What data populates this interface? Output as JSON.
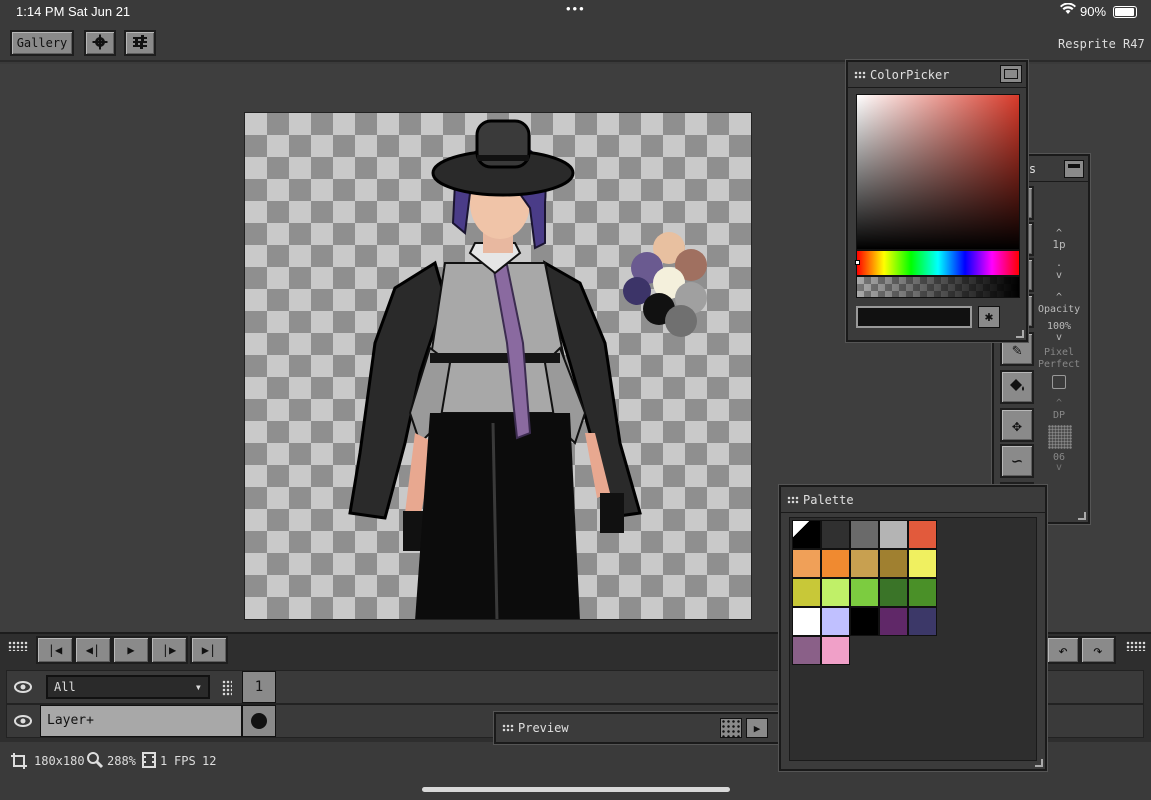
{
  "status": {
    "time": "1:14 PM",
    "date": "Sat Jun 21",
    "battery": "90%"
  },
  "toolbar": {
    "gallery_label": "Gallery",
    "app_name": "Resprite R47"
  },
  "colorpicker": {
    "title": "ColorPicker",
    "hex_value": ""
  },
  "tools": {
    "title": "Tools",
    "brush_size": "1p",
    "opacity_label": "Opacity",
    "opacity_value": "100%",
    "pixel_perfect_label_1": "Pixel",
    "pixel_perfect_label_2": "Perfect",
    "dp_label": "DP",
    "dp_value": "06"
  },
  "palette": {
    "title": "Palette",
    "colors": [
      "#000000",
      "#303030",
      "#6a6a6a",
      "#b4b4b4",
      "#e25a3c",
      "#f0a058",
      "#f08a30",
      "#c8a050",
      "#a08030",
      "#f0f060",
      "#c8c838",
      "#c0f068",
      "#7ccc40",
      "#3a7428",
      "#4a9028",
      "#ffffff",
      "#c0c0ff",
      "#000000",
      "#602868",
      "#3c3868",
      "#8a6088",
      "#f0a0c8"
    ]
  },
  "preview": {
    "title": "Preview"
  },
  "layers": {
    "filter": "All",
    "frame_number": "1",
    "layer_name": "Layer+"
  },
  "info": {
    "canvas_size": "180x180",
    "zoom": "288%",
    "frames": "1",
    "fps_label": "FPS",
    "fps_value": "12"
  },
  "colors": {
    "accent": "#d84a3a",
    "panel": "#3b3b3b",
    "button": "#8a8a8a"
  }
}
